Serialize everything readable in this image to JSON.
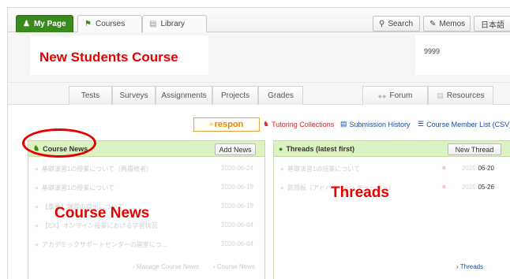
{
  "topbar": {
    "tabs": [
      {
        "label": "My Page",
        "icon": "person-icon",
        "active": true
      },
      {
        "label": "Courses",
        "icon": "courses-icon",
        "active": false
      },
      {
        "label": "Library",
        "icon": "library-icon",
        "active": false
      }
    ],
    "search_label": "Search",
    "memos_label": "Memos",
    "language_label": "日本語"
  },
  "course": {
    "title": "New Students Course",
    "code": "9999"
  },
  "nav": {
    "tabs": [
      "Tests",
      "Surveys",
      "Assignments",
      "Projects",
      "Grades"
    ],
    "forum_label": "Forum",
    "resources_label": "Resources"
  },
  "links": {
    "respon_label": "respon",
    "tutoring_label": "Tutoring Collections",
    "submission_label": "Submission History",
    "member_list_label": "Course Member List (CSV)"
  },
  "course_news": {
    "title": "Course News",
    "add_button": "Add News",
    "items": [
      {
        "text": "基礎演習1の授業について（再履修者）",
        "date": "2020-06-24"
      },
      {
        "text": "基礎演習1の授業について",
        "date": "2020-06-19"
      },
      {
        "text": "【重要】課題の提出について",
        "date": "2020-06-19"
      },
      {
        "text": "【EX】オンライン授業における学習状況",
        "date": "2020-06-04"
      },
      {
        "text": "アカデミックサポートセンターの開室につ...",
        "date": "2020-06-04"
      }
    ],
    "manage_link": "Manage Course News",
    "more_link": "Course News"
  },
  "threads": {
    "title": "Threads (latest first)",
    "new_button": "New Thread",
    "items": [
      {
        "text": "基礎演習1の授業について",
        "date_faded": "2020-",
        "date_visible": "06-20"
      },
      {
        "text": "質問板（アドバイザー・チューター）",
        "date_faded": "2020-",
        "date_visible": "05-26"
      }
    ],
    "more_link": "Threads"
  },
  "overlays": {
    "course_news": "Course News",
    "threads": "Threads"
  },
  "colors": {
    "accent_green": "#3b8a1e",
    "panel_header": "#dcf2c2",
    "annotation_red": "#e60000",
    "respon_orange": "#e38b00",
    "link_blue": "#1a4fa0"
  }
}
